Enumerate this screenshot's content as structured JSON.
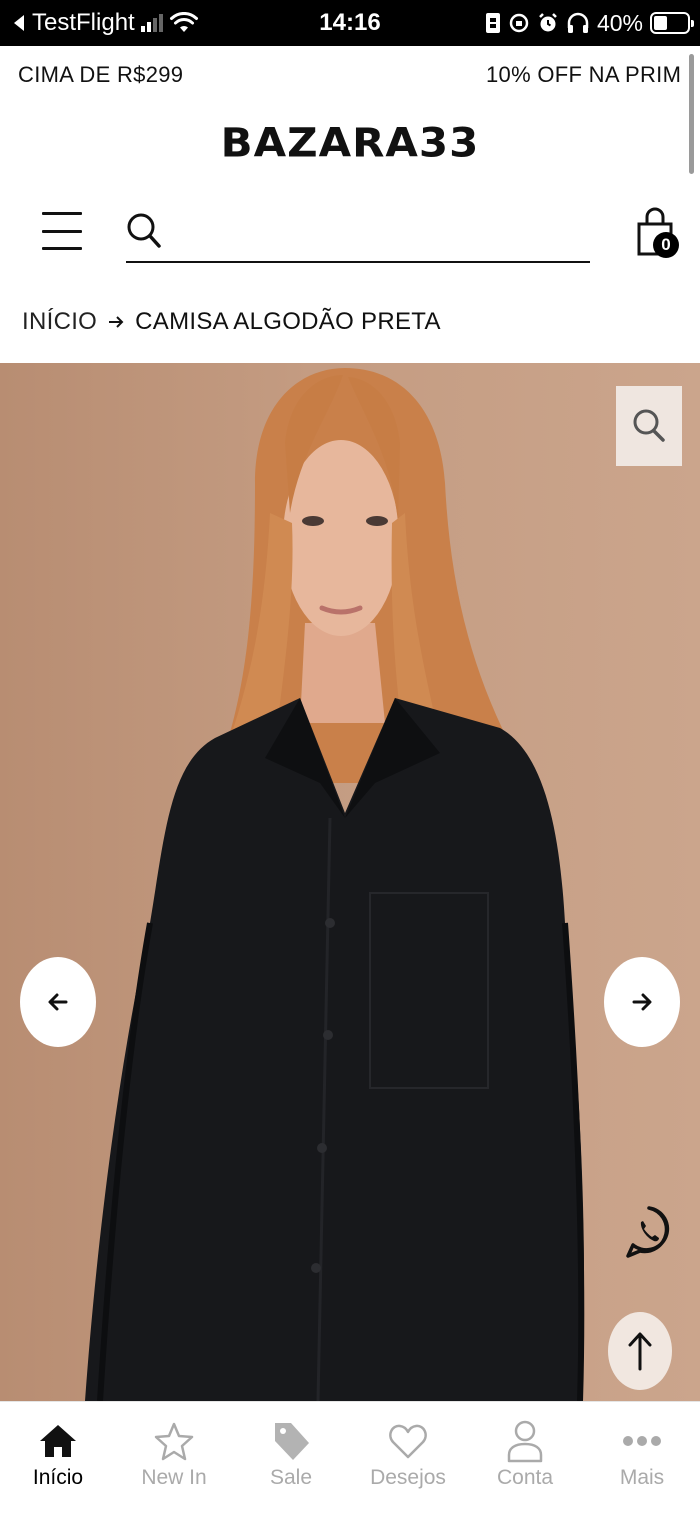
{
  "status_bar": {
    "back_app": "TestFlight",
    "time": "14:16",
    "battery": "40%",
    "battery_level": 0.4
  },
  "promo": {
    "messages": [
      "CIMA DE R$299",
      "10% OFF NA PRIM"
    ]
  },
  "brand": {
    "logo": "BAZARA33"
  },
  "header": {
    "search_placeholder": "",
    "cart_count": "0"
  },
  "breadcrumb": {
    "home": "INÍCIO",
    "current": "CAMISA ALGODÃO PRETA"
  },
  "product": {
    "name": "CAMISA ALGODÃO PRETA",
    "image_alt": "",
    "background_color": "#c49c82",
    "shirt_color": "#17181b"
  },
  "tabs": [
    {
      "label": "Início",
      "icon": "home-icon",
      "active": true
    },
    {
      "label": "New In",
      "icon": "star-icon",
      "active": false
    },
    {
      "label": "Sale",
      "icon": "tag-icon",
      "active": false
    },
    {
      "label": "Desejos",
      "icon": "heart-icon",
      "active": false
    },
    {
      "label": "Conta",
      "icon": "user-icon",
      "active": false
    },
    {
      "label": "Mais",
      "icon": "more-icon",
      "active": false
    }
  ],
  "colors": {
    "text": "#111111",
    "inactive_tab": "#aaaaaa",
    "status_bar_bg": "#000000"
  }
}
